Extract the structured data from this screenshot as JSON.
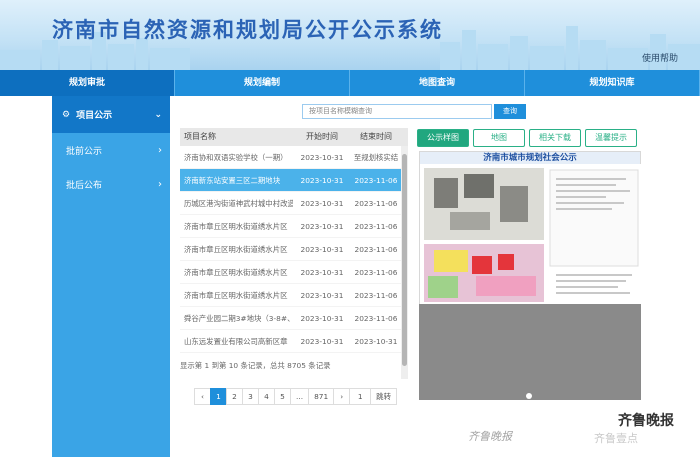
{
  "header": {
    "title": "济南市自然资源和规划局公开公示系统",
    "help": "使用帮助"
  },
  "nav": {
    "items": [
      "规划审批",
      "规划编制",
      "地图查询",
      "规划知识库"
    ],
    "active": 0
  },
  "sidebar": {
    "head": "项目公示",
    "items": [
      "批前公示",
      "批后公布"
    ]
  },
  "search": {
    "placeholder": "按项目名称模糊查询",
    "button": "查询"
  },
  "table": {
    "headers": [
      "项目名称",
      "开始时间",
      "结束时间"
    ],
    "rows": [
      [
        "济南协和双语实验学校（一期）",
        "2023-10-31",
        "至规划核实结"
      ],
      [
        "济南新东站安置三区二期地块",
        "2023-10-31",
        "2023-11-06"
      ],
      [
        "历城区港沟街道神武村城中村改造",
        "2023-10-31",
        "2023-11-06"
      ],
      [
        "济南市章丘区明水街道绣水片区",
        "2023-10-31",
        "2023-11-06"
      ],
      [
        "济南市章丘区明水街道绣水片区",
        "2023-10-31",
        "2023-11-06"
      ],
      [
        "济南市章丘区明水街道绣水片区",
        "2023-10-31",
        "2023-11-06"
      ],
      [
        "济南市章丘区明水街道绣水片区",
        "2023-10-31",
        "2023-11-06"
      ],
      [
        "舜谷产业园二期3#地块（3-8#、",
        "2023-10-31",
        "2023-11-06"
      ],
      [
        "山东远发置业有限公司高新区章",
        "2023-10-31",
        "2023-10-31"
      ]
    ],
    "selected_index": 1
  },
  "pagination": {
    "info": "显示第 1 到第 10 条记录，总共 8705 条记录",
    "prev": "‹",
    "pages": [
      "1",
      "2",
      "3",
      "4",
      "5",
      "...",
      "871"
    ],
    "next": "›",
    "jump_value": "1",
    "jump_label": "跳转"
  },
  "tabs": [
    "公示样图",
    "地图",
    "相关下载",
    "温馨提示"
  ],
  "preview": {
    "title": "济南市城市规划社会公示"
  },
  "watermark": {
    "left": "齐鲁晚报",
    "right": "齐鲁晚报",
    "sub": "齐鲁壹点"
  }
}
